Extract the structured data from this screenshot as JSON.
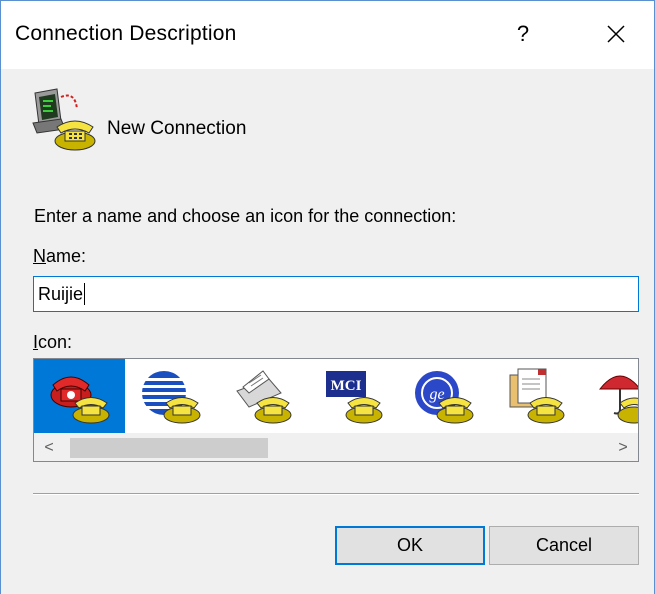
{
  "window": {
    "title": "Connection Description",
    "help_label": "?",
    "close_label": "close"
  },
  "header": {
    "connection_name": "New Connection",
    "icon": "phone-terminal-icon"
  },
  "form": {
    "prompt": "Enter a name and choose an icon for the connection:",
    "name_label_access": "N",
    "name_label_rest": "ame:",
    "name_value": "Ruijie",
    "icon_label_access": "I",
    "icon_label_rest": "con:"
  },
  "icon_list": {
    "items": [
      {
        "name": "red-phone-icon",
        "selected": true
      },
      {
        "name": "globe-icon",
        "selected": false
      },
      {
        "name": "fax-machine-icon",
        "selected": false
      },
      {
        "name": "mci-icon",
        "selected": false
      },
      {
        "name": "ge-icon",
        "selected": false
      },
      {
        "name": "documents-icon",
        "selected": false
      },
      {
        "name": "umbrella-icon",
        "selected": false
      }
    ],
    "scroll_left": "<",
    "scroll_right": ">"
  },
  "buttons": {
    "ok": "OK",
    "cancel": "Cancel"
  },
  "colors": {
    "accent": "#0078d7",
    "window_bg": "#f0f0f0",
    "border": "#5a8fd0"
  }
}
